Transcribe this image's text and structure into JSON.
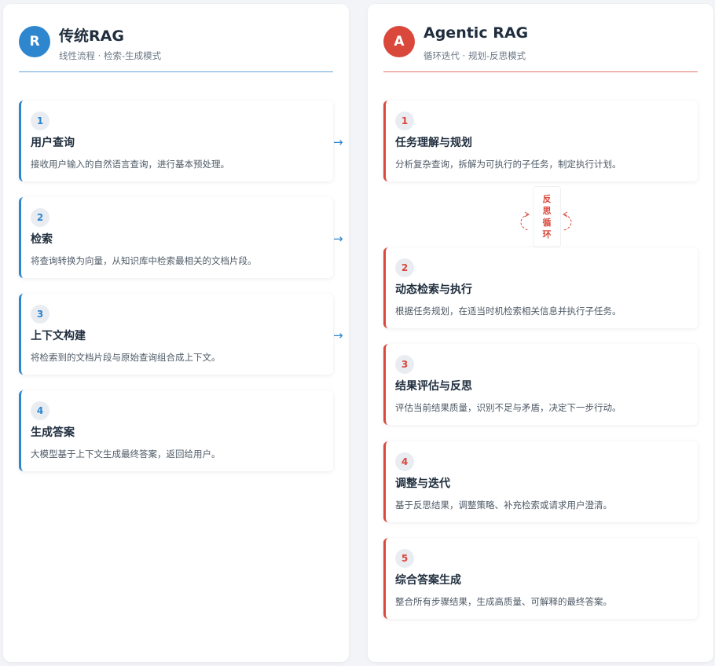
{
  "colors": {
    "traditional": "#2e86cf",
    "agentic": "#d9483b"
  },
  "traditional": {
    "avatar": "R",
    "title": "传统RAG",
    "subtitle": "线性流程 · 检索-生成模式",
    "steps": [
      {
        "num": "1",
        "title": "用户查询",
        "desc": "接收用户输入的自然语言查询，进行基本预处理。"
      },
      {
        "num": "2",
        "title": "检索",
        "desc": "将查询转换为向量，从知识库中检索最相关的文档片段。"
      },
      {
        "num": "3",
        "title": "上下文构建",
        "desc": "将检索到的文档片段与原始查询组合成上下文。"
      },
      {
        "num": "4",
        "title": "生成答案",
        "desc": "大模型基于上下文生成最终答案，返回给用户。"
      }
    ],
    "arrow": "→"
  },
  "agentic": {
    "avatar": "A",
    "title": "Agentic RAG",
    "subtitle": "循环迭代 · 规划-反思模式",
    "loop_label": [
      "反",
      "思",
      "循",
      "环"
    ],
    "steps": [
      {
        "num": "1",
        "title": "任务理解与规划",
        "desc": "分析复杂查询，拆解为可执行的子任务，制定执行计划。"
      },
      {
        "num": "2",
        "title": "动态检索与执行",
        "desc": "根据任务规划，在适当时机检索相关信息并执行子任务。"
      },
      {
        "num": "3",
        "title": "结果评估与反思",
        "desc": "评估当前结果质量，识别不足与矛盾，决定下一步行动。"
      },
      {
        "num": "4",
        "title": "调整与迭代",
        "desc": "基于反思结果，调整策略、补充检索或请求用户澄清。"
      },
      {
        "num": "5",
        "title": "综合答案生成",
        "desc": "整合所有步骤结果，生成高质量、可解释的最终答案。"
      }
    ]
  }
}
